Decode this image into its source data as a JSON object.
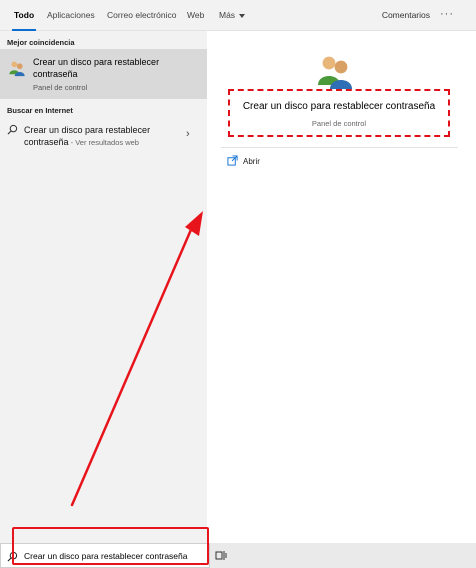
{
  "tabs": [
    {
      "label": "Todo"
    },
    {
      "label": "Aplicaciones"
    },
    {
      "label": "Correo electrónico"
    },
    {
      "label": "Web"
    },
    {
      "label": "Más"
    }
  ],
  "header": {
    "comments_label": "Comentarios",
    "more_label": "···"
  },
  "left": {
    "best_match_header": "Mejor coincidencia",
    "best_match": {
      "title": "Crear un disco para restablecer contraseña",
      "subtitle": "Panel de control"
    },
    "web_header": "Buscar en Internet",
    "web_result": {
      "text": "Crear un disco para restablecer contraseña",
      "hint": " - Ver resultados web"
    }
  },
  "right": {
    "title": "Crear un disco para restablecer contraseña",
    "subtitle": "Panel de control",
    "open_label": "Abrir"
  },
  "taskbar": {
    "search_value": "Crear un disco para restablecer contraseña"
  },
  "colors": {
    "highlight": "#e0101a",
    "accent": "#0a6ed1",
    "selected_row": "#d9d9d9"
  },
  "icons": [
    "users-icon",
    "search-icon",
    "open-icon",
    "chevron-right-icon",
    "task-view-icon"
  ]
}
